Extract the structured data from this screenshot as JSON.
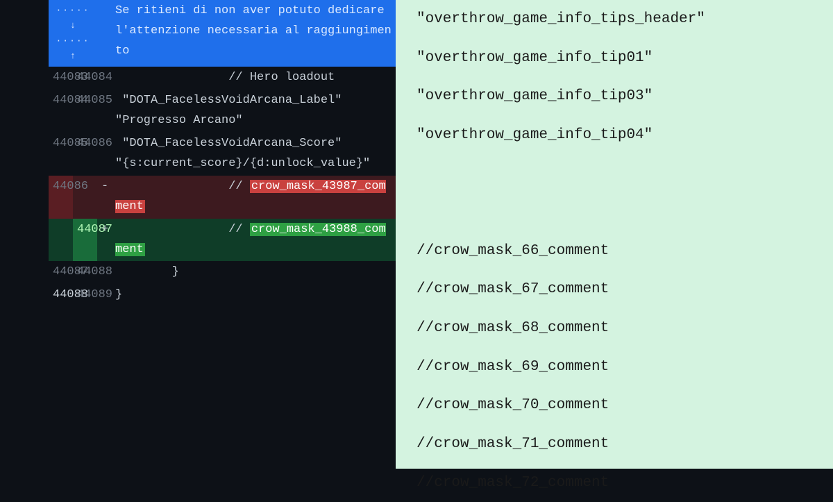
{
  "hunk": {
    "expand_down_icon": "↓",
    "expand_up_icon": "↑",
    "context_text": "Se ritieni di non aver potuto dedicare l'attenzione necessaria al raggiungimento"
  },
  "rows": [
    {
      "old": "44083",
      "new": "44084",
      "marker": "",
      "content": "                // Hero loadout",
      "type": "ctx"
    },
    {
      "old": "44084",
      "new": "44085",
      "marker": "",
      "content": " \"DOTA_FacelessVoidArcana_Label\"                     \"Progresso Arcano\"",
      "type": "ctx"
    },
    {
      "old": "44085",
      "new": "44086",
      "marker": "",
      "content": " \"DOTA_FacelessVoidArcana_Score\"                     \"{s:current_score}/{d:unlock_value}\"",
      "type": "ctx"
    },
    {
      "old": "44086",
      "new": "",
      "marker": "-",
      "content": "                // ",
      "highlight": "crow_mask_43987_comment",
      "type": "del"
    },
    {
      "old": "",
      "new": "44087",
      "marker": "+",
      "content": "                // ",
      "highlight": "crow_mask_43988_comment",
      "type": "add"
    },
    {
      "old": "44087",
      "new": "44088",
      "marker": "",
      "content": "        }",
      "type": "ctx"
    },
    {
      "old": "44088",
      "new": "44089",
      "marker": "",
      "content": "}",
      "type": "ctx"
    }
  ],
  "right_lines": [
    "\"overthrow_game_info_tips_header\"",
    "\"overthrow_game_info_tip01\"",
    "\"overthrow_game_info_tip03\"",
    "\"overthrow_game_info_tip04\"",
    "",
    "",
    "//crow_mask_66_comment",
    "//crow_mask_67_comment",
    "//crow_mask_68_comment",
    "//crow_mask_69_comment",
    "//crow_mask_70_comment",
    "//crow_mask_71_comment",
    "//crow_mask_72_comment"
  ]
}
